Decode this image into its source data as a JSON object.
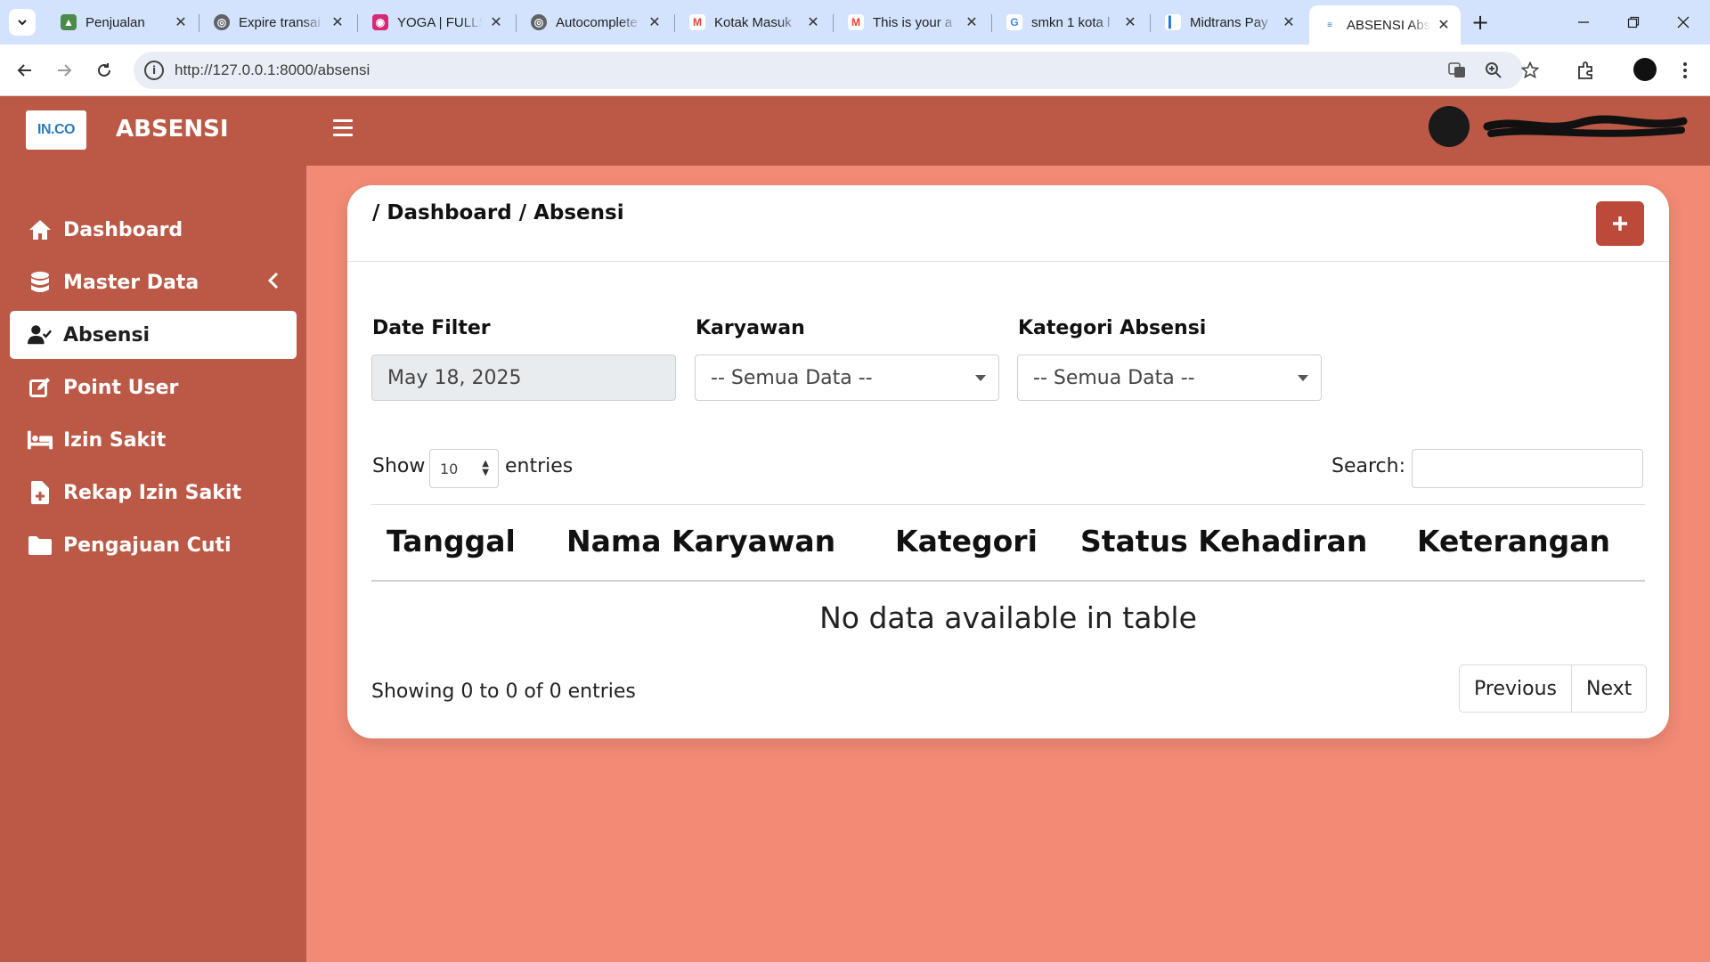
{
  "browser": {
    "tabs": [
      {
        "label": "Penjualan",
        "favicon": "chart-favicon",
        "favicon_color": "#4b8a4b"
      },
      {
        "label": "Expire transai",
        "favicon": "globe-favicon",
        "favicon_color": "#5f6368"
      },
      {
        "label": "YOGA | FULLS",
        "favicon": "instagram-favicon",
        "favicon_color": "#d62976"
      },
      {
        "label": "Autocomplete",
        "favicon": "globe-favicon",
        "favicon_color": "#5f6368"
      },
      {
        "label": "Kotak Masuk",
        "favicon": "gmail-favicon",
        "favicon_color": "#ea4335"
      },
      {
        "label": "This is your a",
        "favicon": "gmail-favicon",
        "favicon_color": "#ea4335"
      },
      {
        "label": "smkn 1 kota l",
        "favicon": "google-favicon",
        "favicon_color": "#4285f4"
      },
      {
        "label": "Midtrans Pay",
        "favicon": "midtrans-favicon",
        "favicon_color": "#1a73e8"
      },
      {
        "label": "ABSENSI Abs",
        "favicon": "app-favicon",
        "favicon_color": "#2b7bbd"
      }
    ],
    "url": "http://127.0.0.1:8000/absensi"
  },
  "sidebar": {
    "brand_logo_text": "IN.CO",
    "brand_name": "ABSENSI",
    "items": [
      {
        "label": "Dashboard",
        "icon": "home-icon",
        "active": false
      },
      {
        "label": "Master Data",
        "icon": "database-icon",
        "active": false,
        "has_submenu": true
      },
      {
        "label": "Absensi",
        "icon": "user-check-icon",
        "active": true
      },
      {
        "label": "Point User",
        "icon": "edit-icon",
        "active": false
      },
      {
        "label": "Izin Sakit",
        "icon": "bed-icon",
        "active": false
      },
      {
        "label": "Rekap Izin Sakit",
        "icon": "file-medical-icon",
        "active": false
      },
      {
        "label": "Pengajuan Cuti",
        "icon": "folder-icon",
        "active": false
      }
    ]
  },
  "colors": {
    "primary": "#bb5946",
    "page_background": "#f28a75",
    "add_button": "#bb4a3a"
  },
  "breadcrumb": [
    "/",
    "Dashboard",
    "/",
    "Absensi"
  ],
  "filters": {
    "date_label": "Date Filter",
    "date_value": "May 18, 2025",
    "karyawan_label": "Karyawan",
    "karyawan_value": "-- Semua Data --",
    "kategori_label": "Kategori Absensi",
    "kategori_value": "-- Semua Data --"
  },
  "table": {
    "show_label": "Show",
    "entries_label": "entries",
    "page_length": "10",
    "search_label": "Search:",
    "columns": [
      "Tanggal",
      "Nama Karyawan",
      "Kategori",
      "Status Kehadiran",
      "Keterangan"
    ],
    "empty_message": "No data available in table",
    "info": "Showing 0 to 0 of 0 entries",
    "prev_label": "Previous",
    "next_label": "Next"
  }
}
